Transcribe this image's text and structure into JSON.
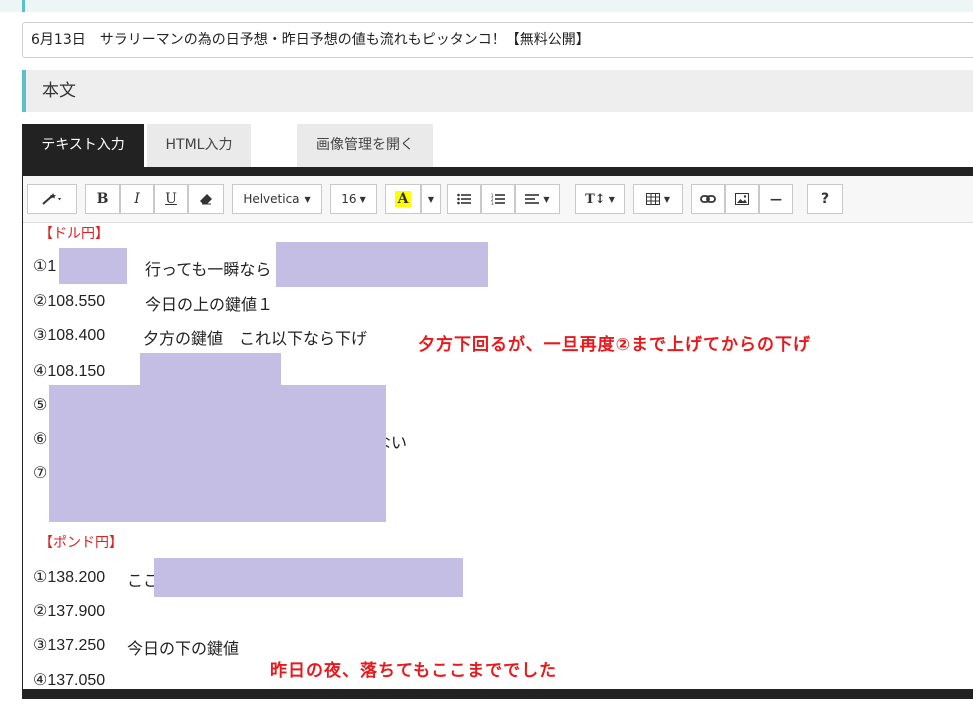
{
  "title": {
    "value": "6月13日　サラリーマンの為の日予想・昨日予想の値も流れもピッタンコ！【無料公開】"
  },
  "section": {
    "label": "本文"
  },
  "tabs": [
    {
      "label": "テキスト入力",
      "active": true
    },
    {
      "label": "HTML入力",
      "active": false
    },
    {
      "label": "画像管理を開く",
      "active": false
    }
  ],
  "toolbar": {
    "magic": "magic-wand-icon",
    "bold": "B",
    "italic": "I",
    "underline": "U",
    "eraser": "eraser-icon",
    "font_family": "Helvetica",
    "font_size": "16",
    "highlight": "A",
    "highlight_color": "#ffff00",
    "list_ul": "list-unordered-icon",
    "list_ol": "list-ordered-icon",
    "align": "align-icon",
    "text_height": "T↕",
    "table": "table-icon",
    "link": "link-icon",
    "image": "image-icon",
    "hr": "—",
    "help": "?"
  },
  "content": {
    "usd_header": "【ドル円】",
    "usd_lines": [
      {
        "num": "①1",
        "text": "行っても一瞬なら"
      },
      {
        "num": "②108.550",
        "text": "今日の上の鍵値１"
      },
      {
        "num": "③108.400",
        "text": "夕方の鍵値　これ以下なら下げ"
      },
      {
        "num": "④108.150",
        "text": ""
      },
      {
        "num": "⑤",
        "text": ""
      },
      {
        "num": "⑥",
        "text": "ない"
      },
      {
        "num": "⑦",
        "text": ""
      }
    ],
    "gbp_header": "【ポンド円】",
    "gbp_lines": [
      {
        "num": "①138.200",
        "text": "ここ"
      },
      {
        "num": "②137.900",
        "text": ""
      },
      {
        "num": "③137.250",
        "text": "今日の下の鍵値"
      },
      {
        "num": "④137.050",
        "text": ""
      }
    ]
  },
  "annotations": {
    "usd": "夕方下回るが、一旦再度②まで上げてからの下げ",
    "gbp": "昨日の夜、落ちてもここまででした"
  },
  "colors": {
    "accent": "#5bc0c9",
    "annotation": "#e8191d",
    "mask": "#c4bde4"
  }
}
